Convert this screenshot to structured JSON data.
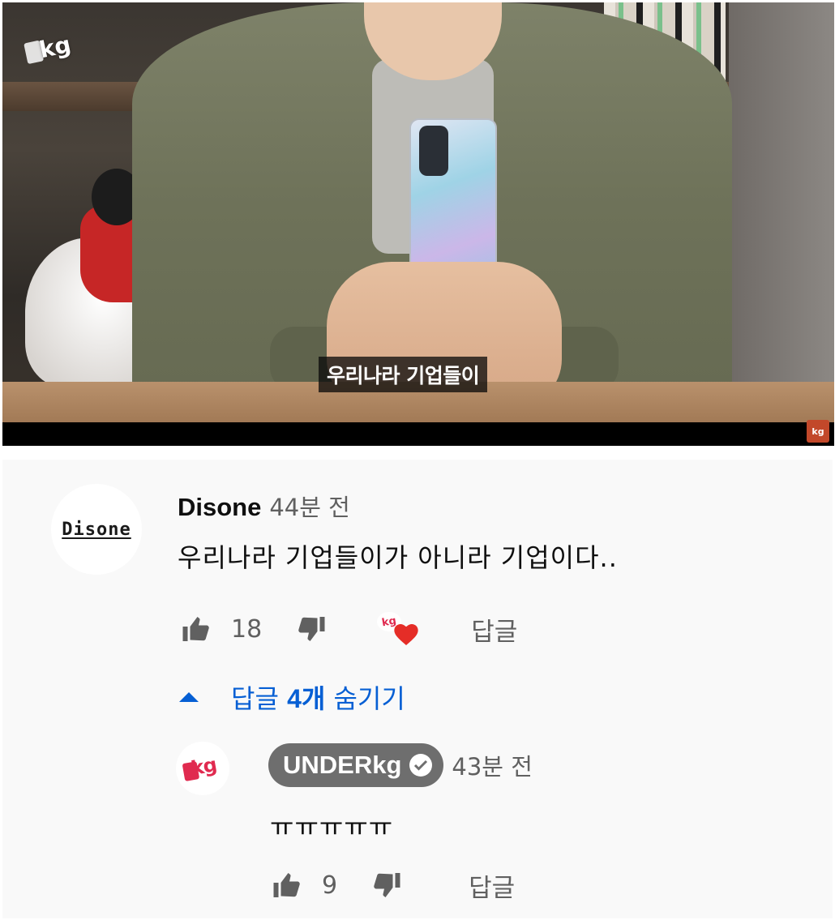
{
  "video": {
    "channel_logo": "kg",
    "subtitle": "우리나라 기업들이",
    "watermark": "kg"
  },
  "comment": {
    "author": "Disone",
    "avatar_text": "Disone",
    "time": "44분 전",
    "text": "우리나라 기업들이가 아니라 기업이다..",
    "likes": "18",
    "reply_label": "답글",
    "creator_heart_badge": "kg",
    "heart_color": "#e52d27"
  },
  "replies_toggle": {
    "prefix": "답글 ",
    "count": "4개",
    "suffix": " 숨기기",
    "color": "#065fd4"
  },
  "reply": {
    "author": "UNDERkg",
    "avatar_text": "kg",
    "verified": true,
    "time": "43분 전",
    "text": "ㅠㅠㅠㅠㅠ",
    "likes": "9",
    "reply_label": "답글"
  },
  "icons": {
    "like": "thumbs-up-icon",
    "dislike": "thumbs-down-icon",
    "expand": "caret-up-icon",
    "verified": "check-circle-icon",
    "heart": "heart-icon"
  }
}
